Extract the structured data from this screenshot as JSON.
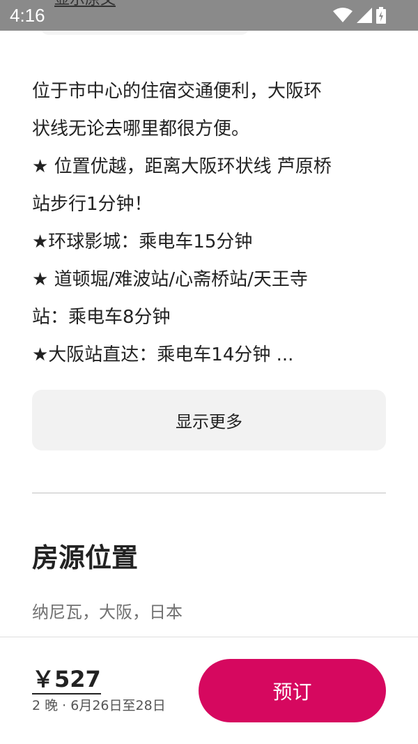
{
  "status_bar": {
    "time": "4:16"
  },
  "peek_link": "显示原文",
  "description": {
    "lines": [
      "位于市中心的住宿交通便利，大阪环",
      "状线无论去哪里都很方便。",
      "★ 位置优越，距离大阪环状线 芦原桥",
      "站步行1分钟！",
      "★环球影城：乘电车15分钟",
      "★ 道顿堀/难波站/心斋桥站/天王寺",
      "站：乘电车8分钟",
      "★大阪站直达：乘电车14分钟 ..."
    ]
  },
  "show_more_label": "显示更多",
  "location_section": {
    "title": "房源位置",
    "location": "纳尼瓦，大阪，日本"
  },
  "booking": {
    "price": "￥527",
    "dates": "2 晚 · 6月26日至28日",
    "book_label": "预订"
  },
  "colors": {
    "accent": "#d6085f",
    "status_bar": "#8a8a8a"
  },
  "icons": [
    "wifi-icon",
    "signal-icon",
    "battery-icon"
  ]
}
